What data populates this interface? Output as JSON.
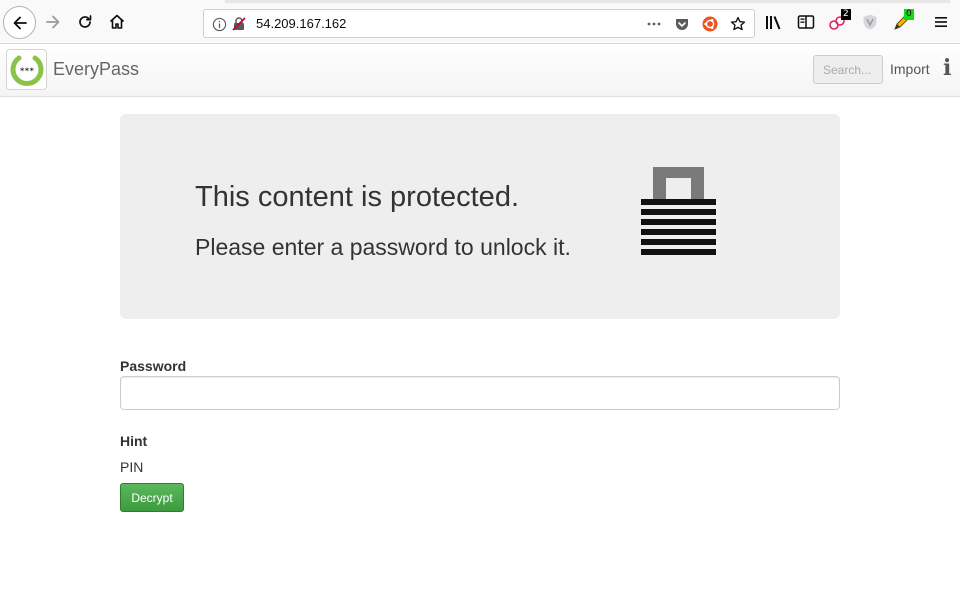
{
  "browser": {
    "url": "54.209.167.162",
    "icons": {
      "back": "back-arrow-icon",
      "forward": "forward-arrow-icon",
      "reload": "reload-icon",
      "home": "home-icon",
      "site_info": "info-circle-icon",
      "insecure": "insecure-lock-icon",
      "page_actions": "more-dots-icon",
      "pocket": "pocket-icon",
      "ubuntu": "ubuntu-icon",
      "bookmark": "star-icon",
      "library": "library-icon",
      "sidebar": "sidebar-icon",
      "menu": "hamburger-menu-icon"
    },
    "extension_badges": {
      "first": "2",
      "third": "0"
    }
  },
  "app": {
    "brand": "EveryPass",
    "logo_text": "***",
    "search_placeholder": "Search...",
    "import_label": "Import",
    "info_label": "i"
  },
  "protected": {
    "heading": "This content is protected.",
    "subheading": "Please enter a password to unlock it.",
    "icon": "padlock-icon"
  },
  "form": {
    "password_label": "Password",
    "password_value": "",
    "hint_label": "Hint",
    "hint_value": "PIN",
    "decrypt_label": "Decrypt"
  },
  "colors": {
    "accent_green": "#4cae4c",
    "jumbotron_bg": "#eeeeee",
    "badge_green": "#16d916"
  }
}
